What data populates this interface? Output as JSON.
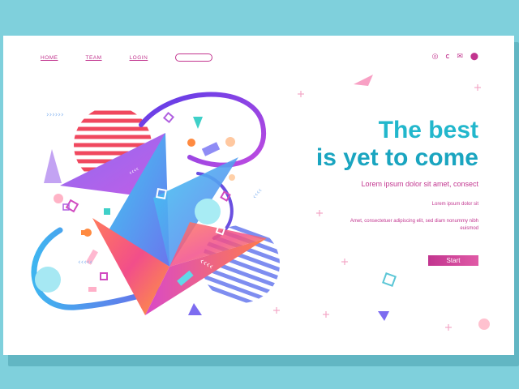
{
  "nav": {
    "home": "HOME",
    "team": "TEAM",
    "login": "LOGIN"
  },
  "social_icons": [
    "instagram-icon",
    "facebook-icon",
    "mail-icon",
    "location-icon"
  ],
  "hero": {
    "title_line1": "The best",
    "title_line2": "is yet to come",
    "subtitle": "Lorem ipsum dolor sit amet, consect",
    "small_line": "Lorem ipsum dolor sit",
    "paragraph": "Amet, consectetuer adipiscing elit, sed diam nonummy nibh euismod",
    "button": "Start"
  },
  "colors": {
    "background": "#7fd0dc",
    "accent_magenta": "#c2358f",
    "accent_cyan": "#1fb0c8"
  }
}
